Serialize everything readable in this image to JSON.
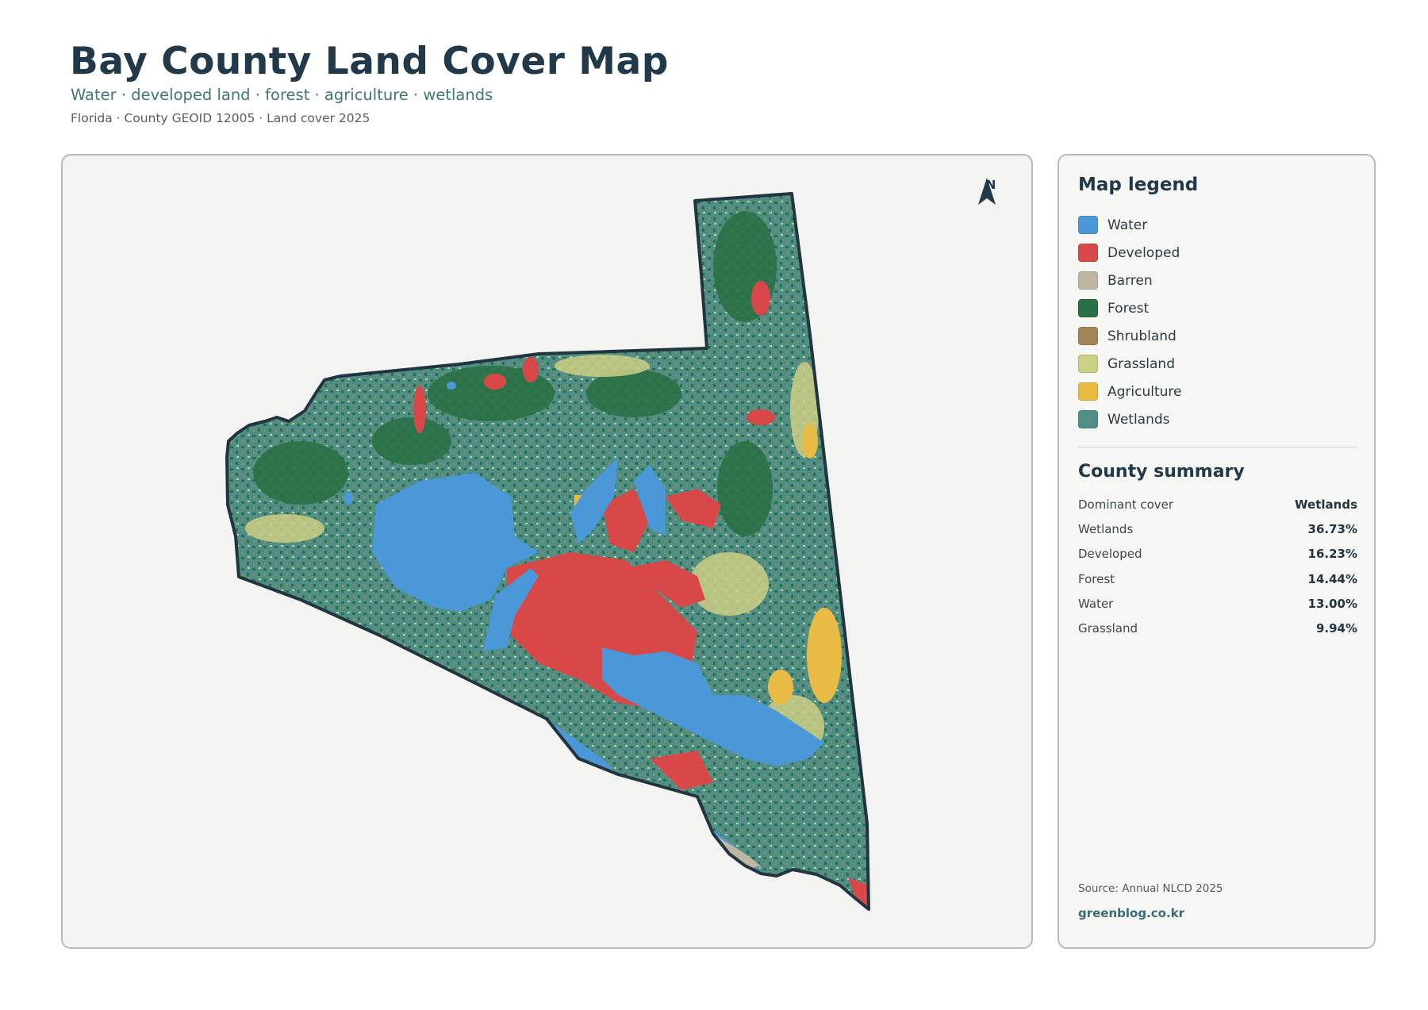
{
  "header": {
    "title": "Bay County Land Cover Map",
    "subtitle": "Water · developed land · forest · agriculture · wetlands",
    "meta": "Florida · County GEOID 12005 · Land cover 2025"
  },
  "map": {
    "north_label": "N",
    "colors": {
      "background": "#f3f3f2",
      "outline": "#22343f"
    }
  },
  "legend": {
    "title": "Map legend",
    "items": [
      {
        "label": "Water",
        "color": "#4a98d8"
      },
      {
        "label": "Developed",
        "color": "#d94848"
      },
      {
        "label": "Barren",
        "color": "#bfb6a2"
      },
      {
        "label": "Forest",
        "color": "#2a7046"
      },
      {
        "label": "Shrubland",
        "color": "#a08755"
      },
      {
        "label": "Grassland",
        "color": "#cdcf85"
      },
      {
        "label": "Agriculture",
        "color": "#e9bb44"
      },
      {
        "label": "Wetlands",
        "color": "#4f8f88"
      }
    ]
  },
  "summary": {
    "title": "County summary",
    "rows": [
      {
        "key": "Dominant cover",
        "value": "Wetlands"
      },
      {
        "key": "Wetlands",
        "value": "36.73%"
      },
      {
        "key": "Developed",
        "value": "16.23%"
      },
      {
        "key": "Forest",
        "value": "14.44%"
      },
      {
        "key": "Water",
        "value": "13.00%"
      },
      {
        "key": "Grassland",
        "value": "9.94%"
      }
    ]
  },
  "footer": {
    "source": "Source: Annual NLCD 2025",
    "site": "greenblog.co.kr"
  }
}
